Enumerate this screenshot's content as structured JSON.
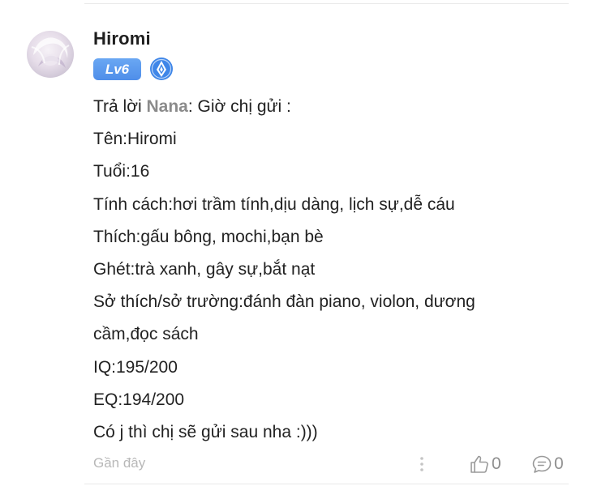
{
  "comment": {
    "author": "Hiromi",
    "level_label": "Lv6",
    "reply_prefix": "Trả lời ",
    "reply_to": "Nana",
    "reply_suffix": ": Giờ chị gửi :",
    "lines": [
      "Tên:Hiromi",
      "Tuổi:16",
      "Tính cách:hơi trầm tính,dịu dàng, lịch sự,dễ cáu",
      "Thích:gấu bông, mochi,bạn bè",
      "Ghét:trà xanh, gây sự,bắt nạt",
      "Sở thích/sở trường:đánh đàn piano, violon, dương",
      "cầm,đọc sách",
      "IQ:195/200",
      "EQ:194/200",
      "Có j thì chị sẽ gửi sau nha :)))"
    ],
    "timestamp": "Gần đây",
    "like_count": "0",
    "reply_count": "0"
  },
  "icons": {
    "avatar": "avatar-image",
    "rank": "blue-rank-emblem-icon",
    "more": "vertical-dots-icon",
    "like": "thumbs-up-icon",
    "reply": "speech-bubble-icon"
  },
  "colors": {
    "level_badge": "#5b9bef",
    "mention": "#8b8b8b",
    "muted": "#b8b8b8",
    "rank_icon": "#3f86e8"
  }
}
